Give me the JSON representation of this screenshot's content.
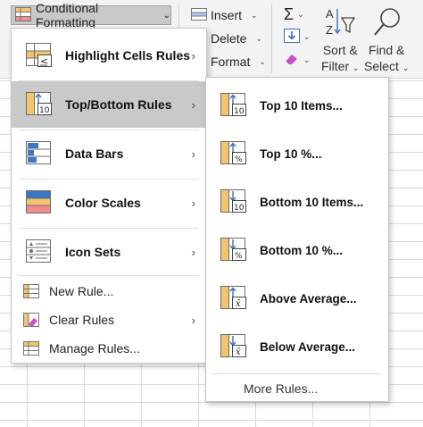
{
  "ribbon": {
    "conditional_formatting_label": "Conditional Formatting",
    "insert_label": "Insert",
    "delete_label": "Delete",
    "format_label": "Format",
    "sort_filter_line1": "Sort &",
    "sort_filter_line2": "Filter",
    "find_select_line1": "Find &",
    "find_select_line2": "Select"
  },
  "main_menu": {
    "items": [
      {
        "label": "Highlight Cells Rules",
        "icon": "highlight-cells-icon"
      },
      {
        "label": "Top/Bottom Rules",
        "icon": "top-bottom-icon"
      },
      {
        "label": "Data Bars",
        "icon": "data-bars-icon"
      },
      {
        "label": "Color Scales",
        "icon": "color-scales-icon"
      },
      {
        "label": "Icon Sets",
        "icon": "icon-sets-icon"
      }
    ],
    "new_rule": "New Rule...",
    "clear_rules": "Clear Rules",
    "manage_rules": "Manage Rules..."
  },
  "sub_menu": {
    "items": [
      {
        "label": "Top 10 Items...",
        "glyph": "10"
      },
      {
        "label": "Top 10 %...",
        "glyph": "%"
      },
      {
        "label": "Bottom 10 Items...",
        "glyph": "10"
      },
      {
        "label": "Bottom 10 %...",
        "glyph": "%"
      },
      {
        "label": "Above Average...",
        "glyph": "x̄"
      },
      {
        "label": "Below Average...",
        "glyph": "x̄"
      }
    ],
    "more_rules": "More Rules..."
  },
  "colors": {
    "selected": "#c9c9c9",
    "cell_border": "#6b6b6b",
    "amber": "#f2c46d",
    "blue_bar": "#3a78c4",
    "red_scale": "#f28b8b",
    "blue_arrow": "#3b6fc0"
  }
}
